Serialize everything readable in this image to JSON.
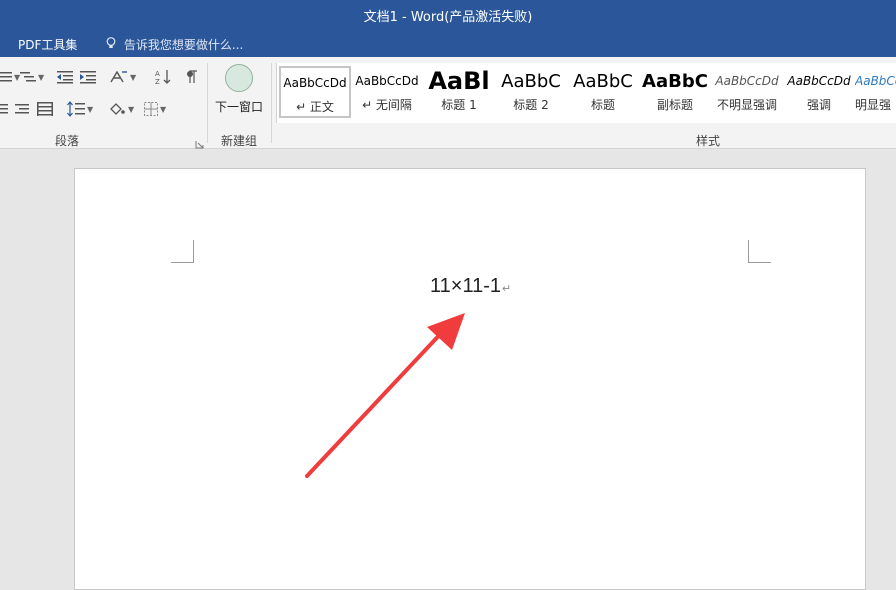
{
  "window": {
    "title": "文档1 - Word(产品激活失败)"
  },
  "menubar": {
    "pdf_tools": "PDF工具集",
    "tell_me_placeholder": "告诉我您想要做什么..."
  },
  "ribbon": {
    "groups": {
      "paragraph": "段落",
      "new_group": "新建组",
      "styles": "样式"
    },
    "new_window": "下一窗口",
    "styles": [
      {
        "preview": "AaBbCcDd",
        "name": "↵ 正文",
        "selected": true
      },
      {
        "preview": "AaBbCcDd",
        "name": "↵ 无间隔"
      },
      {
        "preview": "AaBl",
        "name": "标题 1"
      },
      {
        "preview": "AaBbC",
        "name": "标题 2"
      },
      {
        "preview": "AaBbC",
        "name": "标题"
      },
      {
        "preview": "AaBbC",
        "name": "副标题"
      },
      {
        "preview": "AaBbCcDd",
        "name": "不明显强调"
      },
      {
        "preview": "AaBbCcDd",
        "name": "强调"
      },
      {
        "preview": "AaBbCcDd",
        "name": "明显强"
      }
    ]
  },
  "document": {
    "text": "11×11-1",
    "paragraph_mark": "↵"
  },
  "colors": {
    "accent": "#2b579a",
    "arrow": "#f03c3c"
  }
}
